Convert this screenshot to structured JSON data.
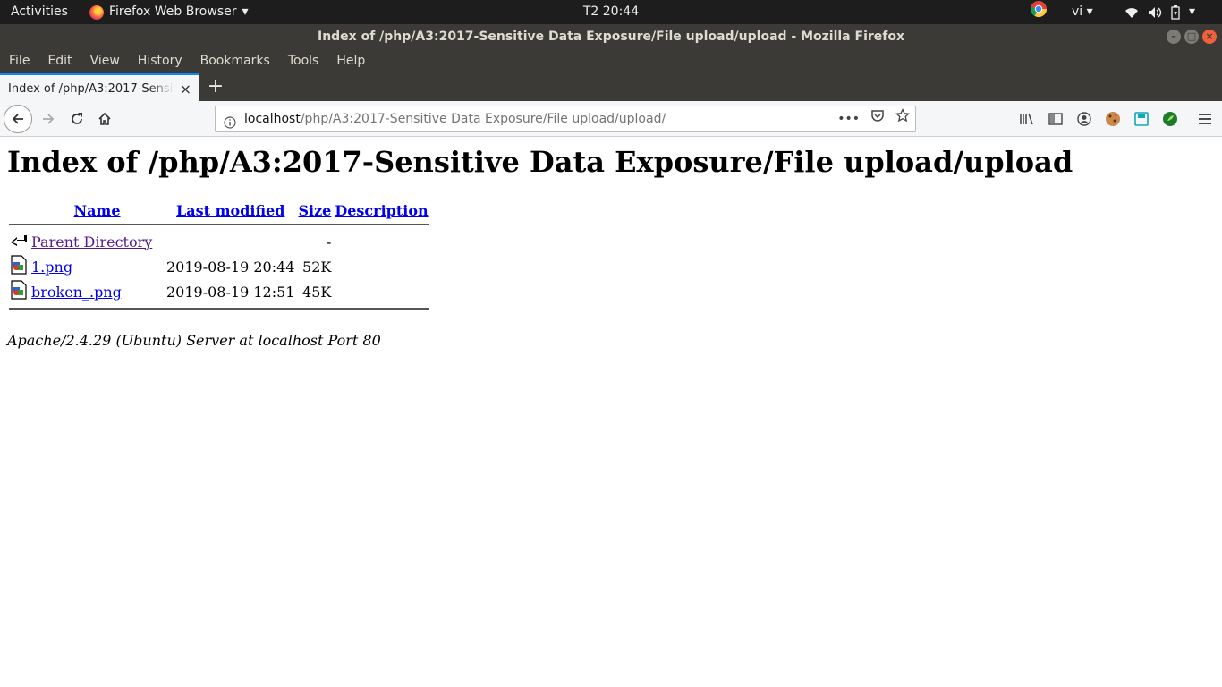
{
  "system": {
    "activities": "Activities",
    "app_name": "Firefox Web Browser",
    "clock": "T2 20:44",
    "language": "vi"
  },
  "window": {
    "title": "Index of /php/A3:2017-Sensitive Data Exposure/File upload/upload - Mozilla Firefox"
  },
  "menu": {
    "file": "File",
    "edit": "Edit",
    "view": "View",
    "history": "History",
    "bookmarks": "Bookmarks",
    "tools": "Tools",
    "help": "Help"
  },
  "tab": {
    "title": "Index of /php/A3:2017-Sensitive Data Exposure/File upload/upload",
    "close": "×",
    "new": "+"
  },
  "urlbar": {
    "host": "localhost",
    "path": "/php/A3:2017-Sensitive Data Exposure/File upload/upload/",
    "more": "•••"
  },
  "page": {
    "heading": "Index of /php/A3:2017-Sensitive Data Exposure/File upload/upload",
    "columns": {
      "name": "Name",
      "last_modified": "Last modified",
      "size": "Size",
      "description": "Description"
    },
    "parent": {
      "name": "Parent Directory",
      "size": "-"
    },
    "files": [
      {
        "name": "1.png",
        "modified": "2019-08-19 20:44",
        "size": "52K"
      },
      {
        "name": "broken_.png",
        "modified": "2019-08-19 12:51",
        "size": "45K"
      }
    ],
    "address": "Apache/2.4.29 (Ubuntu) Server at localhost Port 80"
  }
}
